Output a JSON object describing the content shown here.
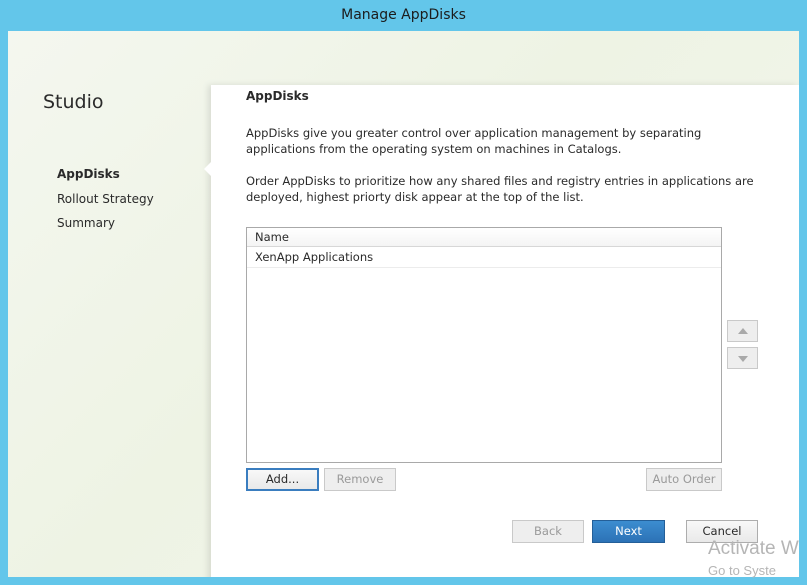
{
  "window": {
    "title": "Manage AppDisks"
  },
  "sidebar": {
    "title": "Studio",
    "items": [
      {
        "label": "AppDisks",
        "active": true
      },
      {
        "label": "Rollout Strategy",
        "active": false
      },
      {
        "label": "Summary",
        "active": false
      }
    ]
  },
  "main": {
    "heading": "AppDisks",
    "paragraph1": "AppDisks give you greater control over application management by separating applications from the operating system on machines in Catalogs.",
    "paragraph2": "Order AppDisks to prioritize how any shared files and registry entries in applications are deployed, highest priorty disk appear at the top of the list.",
    "list": {
      "column_header": "Name",
      "rows": [
        "XenApp Applications"
      ]
    },
    "buttons": {
      "add": "Add...",
      "remove": "Remove",
      "auto_order": "Auto Order"
    },
    "reorder": {
      "up_icon": "triangle-up-icon",
      "down_icon": "triangle-down-icon"
    }
  },
  "footer": {
    "back": "Back",
    "next": "Next",
    "cancel": "Cancel"
  },
  "watermark": {
    "line1": "Activate W",
    "line2": "Go to Syste"
  },
  "colors": {
    "titlebar": "#63c6ea",
    "primary_button": "#2c72b6",
    "focus_border": "#3a7dbf"
  }
}
